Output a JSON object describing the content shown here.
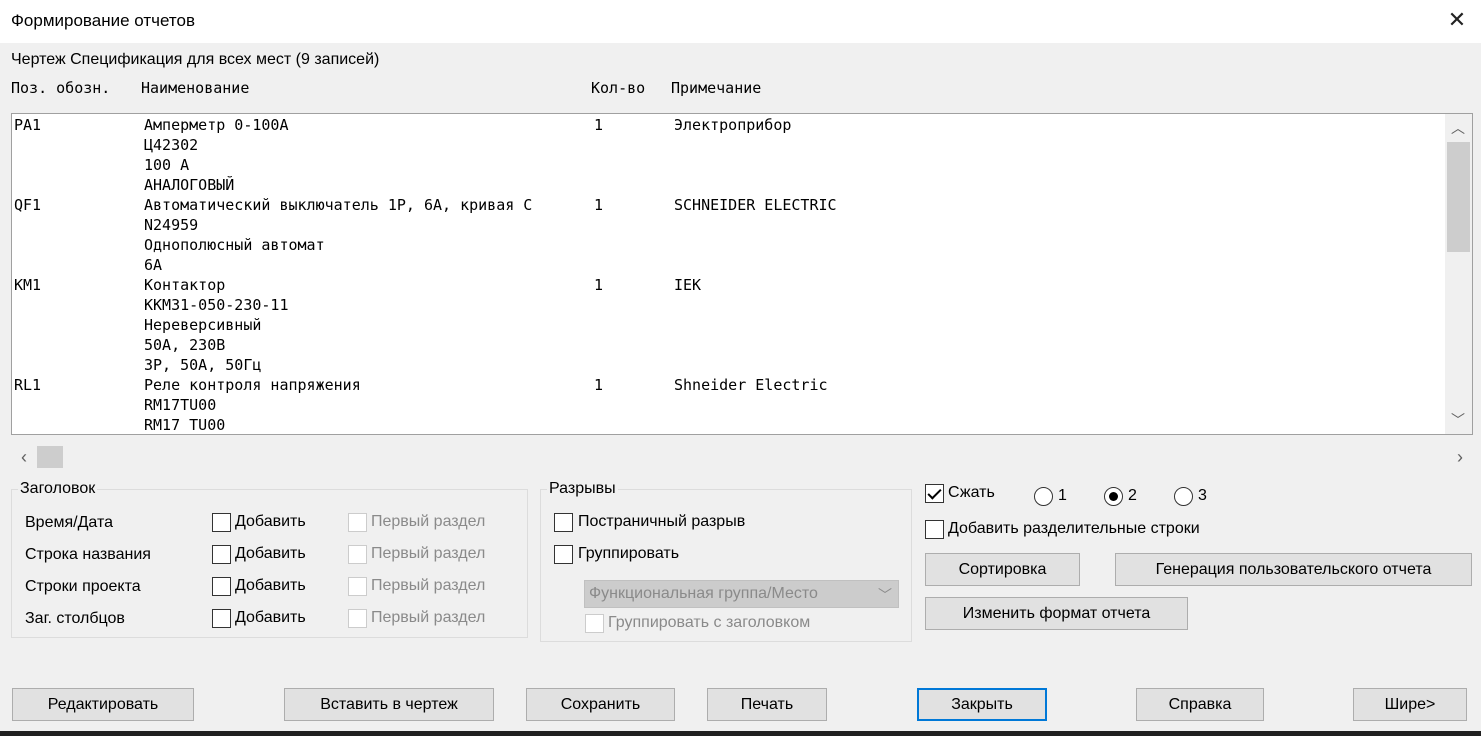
{
  "window": {
    "title": "Формирование отчетов"
  },
  "report": {
    "caption": "Чертеж Спецификация для всех мест (9 записей)",
    "headers": {
      "pos": "Поз. обозн.",
      "name": "Наименование",
      "qty": "Кол-во",
      "note": "Примечание"
    },
    "rows": [
      {
        "pos": "PA1",
        "name": [
          "Амперметр 0-100А",
          "Ц42302",
          "100 А",
          "АНАЛОГОВЫЙ"
        ],
        "qty": "1",
        "note": "Электроприбор"
      },
      {
        "pos": "QF1",
        "name": [
          "Автоматический выключатель 1P, 6А, кривая С",
          "N24959",
          "Однополюсный автомат",
          "6А"
        ],
        "qty": "1",
        "note": "SCHNEIDER ELECTRIC"
      },
      {
        "pos": "KM1",
        "name": [
          "Контактор",
          "KKM31-050-230-11",
          "Нереверсивный",
          "50А, 230В",
          "3P, 50А, 50Гц"
        ],
        "qty": "1",
        "note": "IEK"
      },
      {
        "pos": "RL1",
        "name": [
          "Реле контроля напряжения",
          "RM17TU00",
          "RM17 TU00"
        ],
        "qty": "1",
        "note": "Shneider Electric"
      }
    ]
  },
  "header_group": {
    "title": "Заголовок",
    "rows": [
      {
        "label": "Время/Дата",
        "add": "Добавить",
        "first": "Первый раздел"
      },
      {
        "label": "Строка названия",
        "add": "Добавить",
        "first": "Первый раздел"
      },
      {
        "label": "Строки проекта",
        "add": "Добавить",
        "first": "Первый раздел"
      },
      {
        "label": "Заг. столбцов",
        "add": "Добавить",
        "first": "Первый раздел"
      }
    ]
  },
  "breaks_group": {
    "title": "Разрывы",
    "page_break": "Постраничный разрыв",
    "group": "Группировать",
    "group_by": "Функциональная группа/Место",
    "group_with_header": "Группировать с заголовком"
  },
  "options": {
    "compress": "Сжать",
    "compress_checked": true,
    "radios": [
      "1",
      "2",
      "3"
    ],
    "radio_selected": "2",
    "separator_rows": "Добавить разделительные строки",
    "sort": "Сортировка",
    "custom_report": "Генерация пользовательского отчета",
    "change_format": "Изменить формат отчета"
  },
  "buttons": {
    "edit": "Редактировать",
    "insert": "Вставить в чертеж",
    "save": "Сохранить",
    "print": "Печать",
    "close": "Закрыть",
    "help": "Справка",
    "wider": "Шире>"
  }
}
